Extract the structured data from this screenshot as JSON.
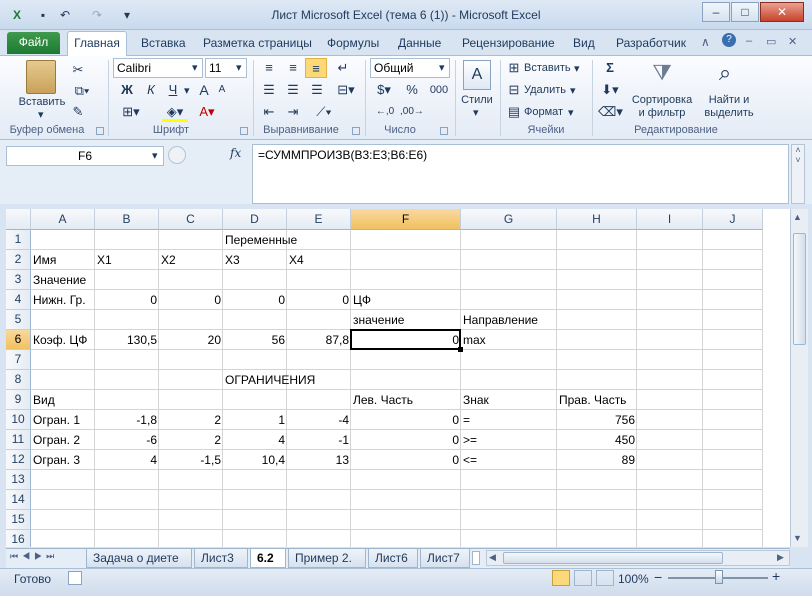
{
  "window": {
    "title": "Лист Microsoft Excel (тема 6 (1))  -  Microsoft Excel",
    "min": "–",
    "max": "□",
    "close": "✕"
  },
  "tabs": {
    "file": "Файл",
    "items": [
      "Главная",
      "Вставка",
      "Разметка страницы",
      "Формулы",
      "Данные",
      "Рецензирование",
      "Вид",
      "Разработчик"
    ]
  },
  "ribbon": {
    "clipboard": {
      "paste": "Вставить",
      "label": "Буфер обмена"
    },
    "font": {
      "name": "Calibri",
      "size": "11",
      "bold": "Ж",
      "italic": "К",
      "underline": "Ч",
      "grow": "A",
      "shrink": "A",
      "label": "Шрифт"
    },
    "alignment": {
      "label": "Выравнивание"
    },
    "number": {
      "format": "Общий",
      "label": "Число",
      "pct": "%",
      "thousands": "000"
    },
    "styles": {
      "label": "Стили"
    },
    "cells": {
      "insert": "Вставить",
      "delete": "Удалить",
      "format": "Формат",
      "label": "Ячейки"
    },
    "editing": {
      "sum": "Σ",
      "sort": "Сортировка и фильтр",
      "find": "Найти и выделить",
      "label": "Редактирование"
    }
  },
  "formula_bar": {
    "name_box": "F6",
    "fx": "fx",
    "formula": "=СУММПРОИЗВ(B3:E3;B6:E6)"
  },
  "columns": [
    "A",
    "B",
    "C",
    "D",
    "E",
    "F",
    "G",
    "H",
    "I",
    "J"
  ],
  "rows": [
    "1",
    "2",
    "3",
    "4",
    "5",
    "6",
    "7",
    "8",
    "9",
    "10",
    "11",
    "12",
    "13",
    "14",
    "15",
    "16"
  ],
  "cells": {
    "D1": "Переменные",
    "A2": "Имя",
    "B2": "X1",
    "C2": "X2",
    "D2": "X3",
    "E2": "X4",
    "A3": "Значение",
    "A4": "Нижн. Гр.",
    "B4": "0",
    "C4": "0",
    "D4": "0",
    "E4": "0",
    "F4": "ЦФ",
    "F5": "значение",
    "G5": "Направление",
    "A6": "Коэф. ЦФ",
    "B6": "130,5",
    "C6": "20",
    "D6": "56",
    "E6": "87,8",
    "F6": "0",
    "G6": "max",
    "D8": "ОГРАНИЧЕНИЯ",
    "A9": "Вид",
    "F9": "Лев. Часть",
    "G9": "Знак",
    "H9": "Прав. Часть",
    "A10": "Огран. 1",
    "B10": "-1,8",
    "C10": "2",
    "D10": "1",
    "E10": "-4",
    "F10": "0",
    "G10": "=",
    "H10": "756",
    "A11": "Огран. 2",
    "B11": "-6",
    "C11": "2",
    "D11": "4",
    "E11": "-1",
    "F11": "0",
    "G11": ">=",
    "H11": "450",
    "A12": "Огран. 3",
    "B12": "4",
    "C12": "-1,5",
    "D12": "10,4",
    "E12": "13",
    "F12": "0",
    "G12": "<=",
    "H12": "89"
  },
  "sheets": [
    "Задача о диете",
    "Лист3",
    "6.2",
    "Пример 2.",
    "Лист6",
    "Лист7"
  ],
  "active_sheet": "6.2",
  "status": {
    "ready": "Готово",
    "zoom": "100%",
    "zoom_out": "−",
    "zoom_in": "+"
  }
}
